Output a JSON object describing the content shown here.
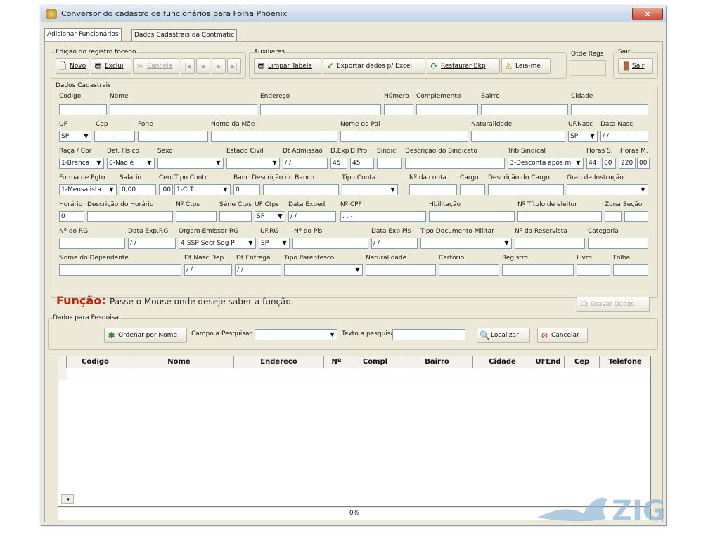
{
  "window": {
    "title": "Conversor do cadastro de funcionários para Folha Phoenix",
    "close": "x"
  },
  "tabs": [
    "Adicionar Funcionários",
    "Dados Cadastrais da Contmatic"
  ],
  "toolbar": {
    "edit_group": "Edição do registro focado",
    "novo": "Novo",
    "excluir": "Exclui",
    "cancela": "Cancela",
    "aux_group": "Auxiliares",
    "limpar": "Limpar Tabela",
    "exportar": "Exportar dados p/ Excel",
    "restaurar": "Restaurar Bkp",
    "leiame": "Leia-me",
    "qtde": "Qtde Regs",
    "sair_group": "Sair",
    "sair": "Sair"
  },
  "form": {
    "group": "Dados Cadastrais",
    "codigo": "Codigo",
    "nome": "Nome",
    "endereco": "Endereço",
    "numero": "Número",
    "complemento": "Complemento",
    "bairro": "Bairro",
    "cidade": "Cidade",
    "uf": "UF",
    "cep": "Cep",
    "fone": "Fone",
    "nome_mae": "Nome da Mãe",
    "nome_pai": "Nome do Pai",
    "naturalidade": "Naturalidade",
    "uf_nasc": "UF.Nasc",
    "data_nasc": "Data Nasc",
    "uf_val": "SP",
    "cep_val": "-",
    "uf_nasc_val": "SP",
    "data_nasc_val": "/ /",
    "raca": "Raça / Cor",
    "def_fisico": "Def. Físico",
    "sexo": "Sexo",
    "estado_civil": "Estado Civil",
    "dt_admissao": "Dt Admissão",
    "d_exp": "D.Exp",
    "d_pro": "D.Pro",
    "sindic": "Sindic",
    "desc_sindicato": "Descrição do Sindicato",
    "trib_sindical": "Trib.Sindical",
    "horas_s": "Horas S.",
    "horas_m": "Horas M.",
    "raca_val": "1-Branca",
    "def_val": "0-Não é",
    "dt_adm_val": "/ /",
    "d_exp_val": "45",
    "d_pro_val": "45",
    "trib_val": "3-Desconta após m",
    "horas_s_val": "44",
    "horas_s_val2": "00",
    "horas_m_val": "220",
    "horas_m_val2": "00",
    "forma_pgto": "Forma de Pgto",
    "salario": "Salário",
    "cent": "Cent",
    "tipo_contr": "Tipo Contr",
    "banco": "Banco",
    "desc_banco": "Descrição do Banco",
    "tipo_conta": "Tipo Conta",
    "n_conta": "Nº da conta",
    "cargo": "Cargo",
    "desc_cargo": "Descrição do Cargo",
    "grau_instrucao": "Grau de Instrução",
    "forma_val": "1-Mensalista",
    "salario_val": "0,00",
    "cent_val": "00",
    "tipo_contr_val": "1-CLT",
    "banco_val": "0",
    "horario": "Horário",
    "desc_horario": "Descrição do Horário",
    "n_ctps": "Nº Ctps",
    "serie_ctps": "Série Ctps",
    "uf_ctps": "UF Ctps",
    "data_exped": "Data Exped",
    "n_cpf": "Nº CPF",
    "habilitacao": "Hbilitação",
    "titulo_eleitor": "Nº Título de eleitor",
    "zona": "Zona",
    "secao": "Seção",
    "horario_val": "0",
    "uf_ctps_val": "SP",
    "data_exped_val": "/ /",
    "cpf_val": ". . -",
    "n_rg": "Nº do RG",
    "data_exp_rg": "Data Exp.RG",
    "orgao_emissor": "Orgam Emissor RG",
    "uf_rg": "UF.RG",
    "n_pis": "Nº do Pis",
    "data_exp_pis": "Data Exp.Pis",
    "tipo_doc_militar": "Tipo Documento Militar",
    "n_reservista": "Nº da Reservista",
    "categoria": "Categoria",
    "data_exp_rg_val": "/ /",
    "orgao_val": "4-SSP Secr Seg P",
    "uf_rg_val": "SP",
    "data_pis_val": "/ /",
    "nome_dependente": "Nome do Dependente",
    "dt_nasc_dep": "Dt Nasc Dep",
    "dt_entrega": "Dt Entrega",
    "tipo_parentesco": "Tipo Parentesco",
    "naturalidade2": "Naturalidade",
    "cartorio": "Cartório",
    "registro": "Registro",
    "livro": "Livro",
    "folha": "Folha",
    "dt_nasc_dep_val": "/ /",
    "dt_entrega_val": "/ /"
  },
  "funcao": {
    "title": "Função:",
    "text": "Passe o Mouse onde deseje saber a função.",
    "gravar": "Gravar Dados"
  },
  "search": {
    "group": "Dados para Pesquisa",
    "ordenar": "Ordenar por Nome",
    "campo": "Campo a Pesquisar",
    "texto": "Texto a pesquisar",
    "localizar": "Localizar",
    "cancelar": "Cancelar"
  },
  "grid": {
    "columns": [
      "Codigo",
      "Nome",
      "Endereco",
      "Nº",
      "Compl",
      "Bairro",
      "Cidade",
      "UFEnd",
      "Cep",
      "Telefone"
    ]
  },
  "status": {
    "progress": "0%"
  },
  "watermark": "ZIGG",
  "colors": {
    "funcao": "#b42a14",
    "accent_blue": "#1f5fbf"
  }
}
